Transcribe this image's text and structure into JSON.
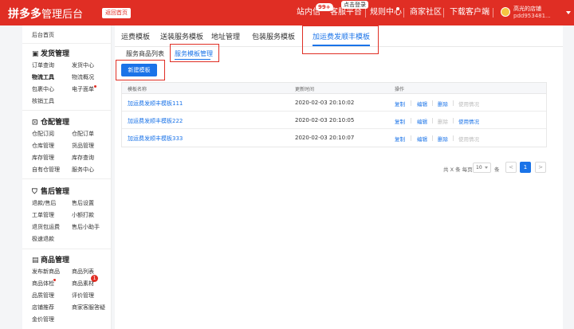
{
  "topbar": {
    "logo_brand": "拼多多",
    "logo_sub": "管理后台",
    "back_home": "返回首页",
    "nav": [
      {
        "label": "站内信",
        "badge": "99+"
      },
      {
        "label": "客服平台",
        "tip": "点击登录"
      },
      {
        "label": "规则中心"
      },
      {
        "label": "商家社区"
      },
      {
        "label": "下载客户端"
      }
    ],
    "user_name": "高光的店铺",
    "user_id": "pdd953481..."
  },
  "sidebar": {
    "home": "后台首页",
    "sections": [
      {
        "title": "发货管理",
        "icon": "delivery-icon",
        "items": [
          "订单查询",
          "发货中心",
          "物流工具",
          "物流概况",
          "包裹中心",
          "电子面单",
          "核销工具"
        ]
      },
      {
        "title": "仓配管理",
        "icon": "warehouse-icon",
        "items": [
          "仓配订阅",
          "仓配订单",
          "仓库管理",
          "货品管理",
          "库存管理",
          "库存查询",
          "自有仓管理",
          "服务中心"
        ]
      },
      {
        "title": "售后管理",
        "icon": "shield-icon",
        "items": [
          "退款/售后",
          "售后设置",
          "工单管理",
          "小额打款",
          "退货包运费",
          "售后小助手",
          "极速退款"
        ]
      },
      {
        "title": "商品管理",
        "icon": "goods-icon",
        "items": [
          "发布新商品",
          "商品列表",
          "商品体检",
          "商品素材",
          "品质管理",
          "评价管理",
          "店铺推荐",
          "商家客服答疑",
          "金价管理"
        ]
      }
    ],
    "active_item": "物流工具",
    "material_count": "1"
  },
  "main": {
    "tabs": [
      "运费模板",
      "送装服务模板",
      "地址管理",
      "包装服务模板",
      "加运费发顺丰模板"
    ],
    "active_tab": "加运费发顺丰模板",
    "subtabs": [
      "服务商品列表",
      "服务模板管理"
    ],
    "active_subtab": "服务模板管理",
    "new_button": "新建模板",
    "table": {
      "headers": [
        "模板名称",
        "更新时间",
        "操作"
      ],
      "rows": [
        {
          "name": "加运费发顺丰模板111",
          "time": "2020-02-03 20:10:02",
          "ops": [
            "复制",
            "编辑",
            "删除",
            "使用情况"
          ],
          "ops_enabled": [
            true,
            true,
            true,
            false
          ]
        },
        {
          "name": "加运费发顺丰模板222",
          "time": "2020-02-03 20:10:05",
          "ops": [
            "复制",
            "编辑",
            "删除",
            "使用情况"
          ],
          "ops_enabled": [
            true,
            true,
            false,
            true
          ]
        },
        {
          "name": "加运费发顺丰模板333",
          "time": "2020-02-03 20:10:07",
          "ops": [
            "复制",
            "编辑",
            "删除",
            "使用情况"
          ],
          "ops_enabled": [
            true,
            true,
            true,
            false
          ]
        }
      ]
    },
    "pager": {
      "summary": "共 X 条 每页",
      "page_size": "10",
      "unit": "条",
      "prev": "<",
      "current": "1",
      "next": ">"
    }
  },
  "colors": {
    "brand": "#e02e24",
    "accent": "#1a73e8",
    "highlight_box": "#e02e24"
  }
}
